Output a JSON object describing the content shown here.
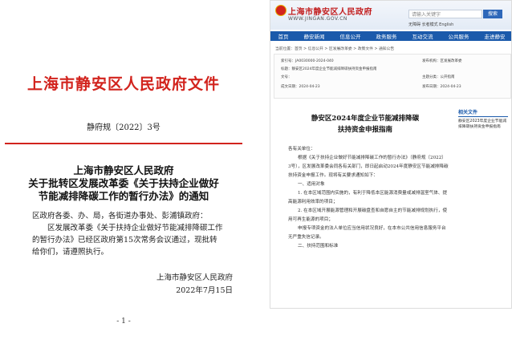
{
  "document": {
    "title": "上海市静安区人民政府文件",
    "number": "静府规〔2022〕3号",
    "notice_title_lines": [
      "上海市静安区人民政府",
      "关于批转区发展改革委《关于扶持企业做好",
      "节能减排降碳工作的暂行办法》的通知"
    ],
    "salutation": "区政府各委、办、局，各街道办事处、彭浦镇政府：",
    "body": "区发展改革委《关于扶持企业做好节能减排降碳工作的暂行办法》已经区政府第15次常务会议通过，现批转给你们，请遵照执行。",
    "signer": "上海市静安区人民政府",
    "date": "2022年7月15日",
    "page": "- 1 -"
  },
  "web": {
    "site_name": "上海市静安区人民政府",
    "site_url": "WWW.JINGAN.GOV.CN",
    "search_placeholder": "请输入关键字",
    "search_button": "搜索",
    "top_links": "无障碍  长者模式  English",
    "nav": [
      "首页",
      "静安新闻",
      "信息公开",
      "政务服务",
      "互动交流",
      "公共服务",
      "走进静安"
    ],
    "breadcrumb": "当前位置：首页 > 信息公开 > 区发展改革委 > 政策文件 > 通知公告",
    "meta": {
      "index_label": "索引号：",
      "index_value": "JA0030000-2024-040",
      "publisher_label": "发布机构：",
      "publisher_value": "区发展改革委",
      "subject_label": "标题：",
      "subject_value": "静安区2024年度企业节能减排降碳扶持资金申报指南",
      "doc_no_label": "文号：",
      "doc_no_value": "",
      "topic_label": "主题分类：",
      "topic_value": "公开指南",
      "date_label": "成文日期：",
      "date_value": "2024-04-23",
      "pubdate_label": "发布日期：",
      "pubdate_value": "2024-04-23"
    },
    "article_title_lines": [
      "静安区2024年度企业节能减排降碳",
      "扶持资金申报指南"
    ],
    "article_salutation": "各有关单位：",
    "article_p1": "根据《关于扶持企业做好节能减排降碳工作的暂行办法》（静府规〔2022〕3号），区发展改革委会同各有关部门，即日起启动2024年度静安区节能减排降碳扶持资金申报工作。现将有关要求通知如下：",
    "article_h1": "一、适用对象",
    "article_p2": "1. 在本区域范围内实施的，有利于降低本区能源消费量或减排温室气体、提高能源利用效率的项目；",
    "article_p3": "2. 在本区域开展能源管理和开展碳盘查和自愿自主的节能减排规划执行，使用可再生能源的项目；",
    "article_p4": "申报专项资金的法人单位应当信用状况良好，在本市公共信用信息服务平台无严重失信记录。",
    "article_h2": "二、扶持范围和标准",
    "sidebar_title": "相关文件",
    "sidebar_text": "静安区2023年度企业节能减排降碳扶持资金申报指南"
  }
}
